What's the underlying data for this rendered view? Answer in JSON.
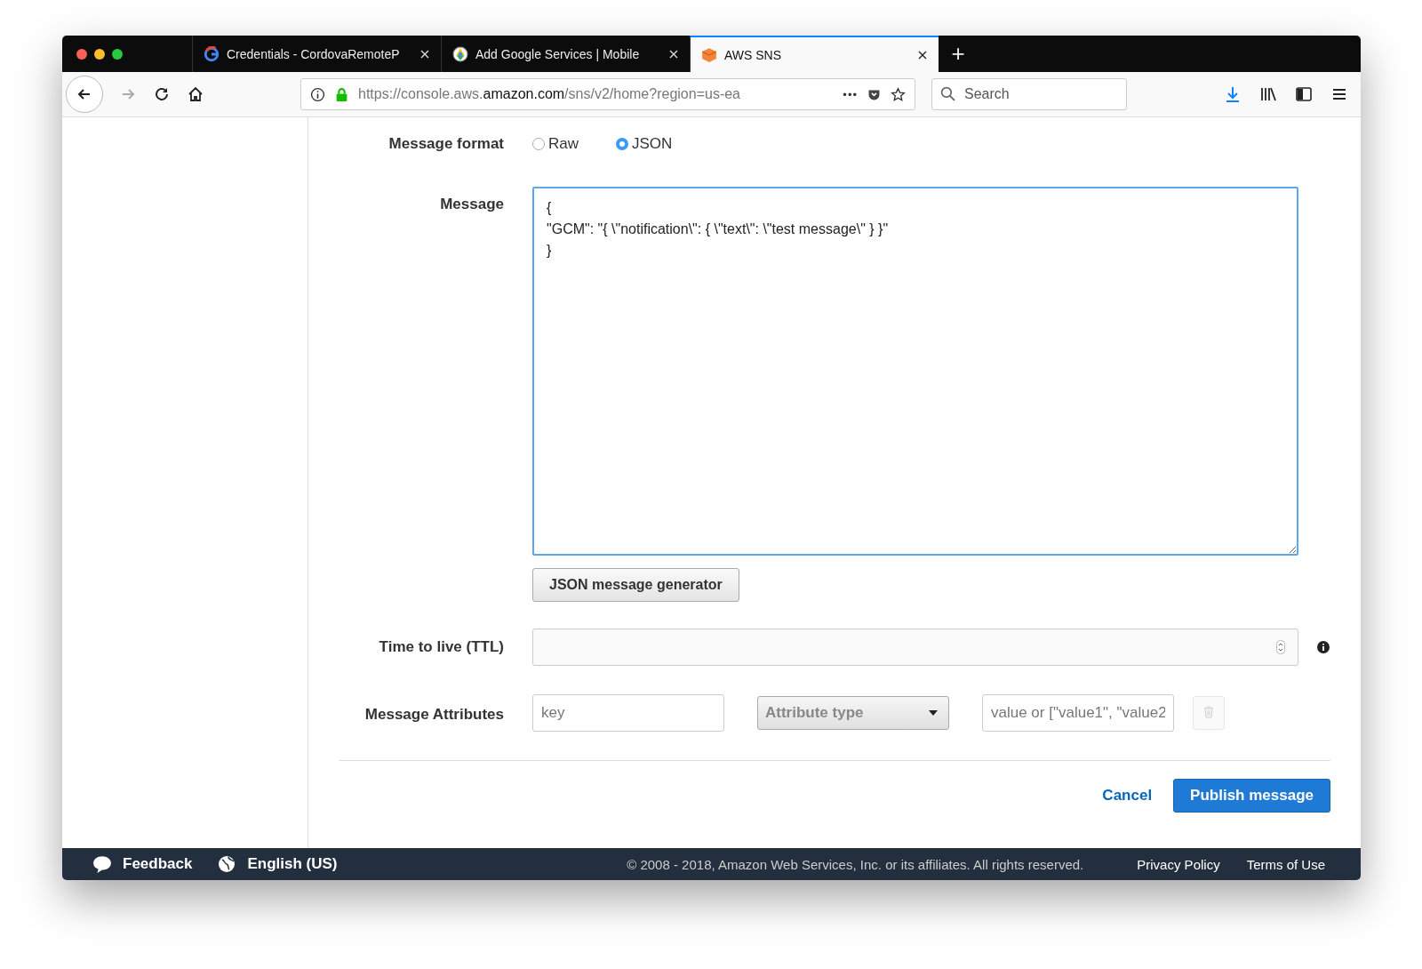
{
  "tabs": [
    {
      "title": "Credentials - CordovaRemoteP",
      "kind": "google",
      "selected": false
    },
    {
      "title": "Add Google Services  |  Mobile",
      "kind": "pinwheel",
      "selected": false
    },
    {
      "title": "AWS SNS",
      "kind": "cube",
      "selected": true
    }
  ],
  "new_tab": "+",
  "address_bar": {
    "url": "https://console.aws.**amazon.com**/sns/v2/home?region=us-ea",
    "more": "•••"
  },
  "search": {
    "placeholder": "Search"
  },
  "form": {
    "message_format": {
      "label": "Message format",
      "options": [
        {
          "label": "Raw",
          "selected": false
        },
        {
          "label": "JSON",
          "selected": true
        }
      ]
    },
    "message": {
      "label": "Message",
      "lines": [
        "{",
        "\"GCM\": \"{ \\\"notification\\\": { \\\"text\\\": \\\"test message\\\" } }\"",
        "}"
      ]
    },
    "generator_button": "JSON message generator",
    "ttl": {
      "label": "Time to live (TTL)"
    },
    "attributes": {
      "label": "Message Attributes",
      "key_placeholder": "key",
      "type_placeholder": "Attribute type",
      "value_placeholder": "value or [\"value1\", \"value2"
    },
    "cancel": "Cancel",
    "publish": "Publish message"
  },
  "footer": {
    "feedback": "Feedback",
    "language": "English (US)",
    "copyright": "© 2008 - 2018, Amazon Web Services, Inc. or its affiliates. All rights reserved.",
    "links": [
      "Privacy Policy",
      "Terms of Use"
    ]
  }
}
